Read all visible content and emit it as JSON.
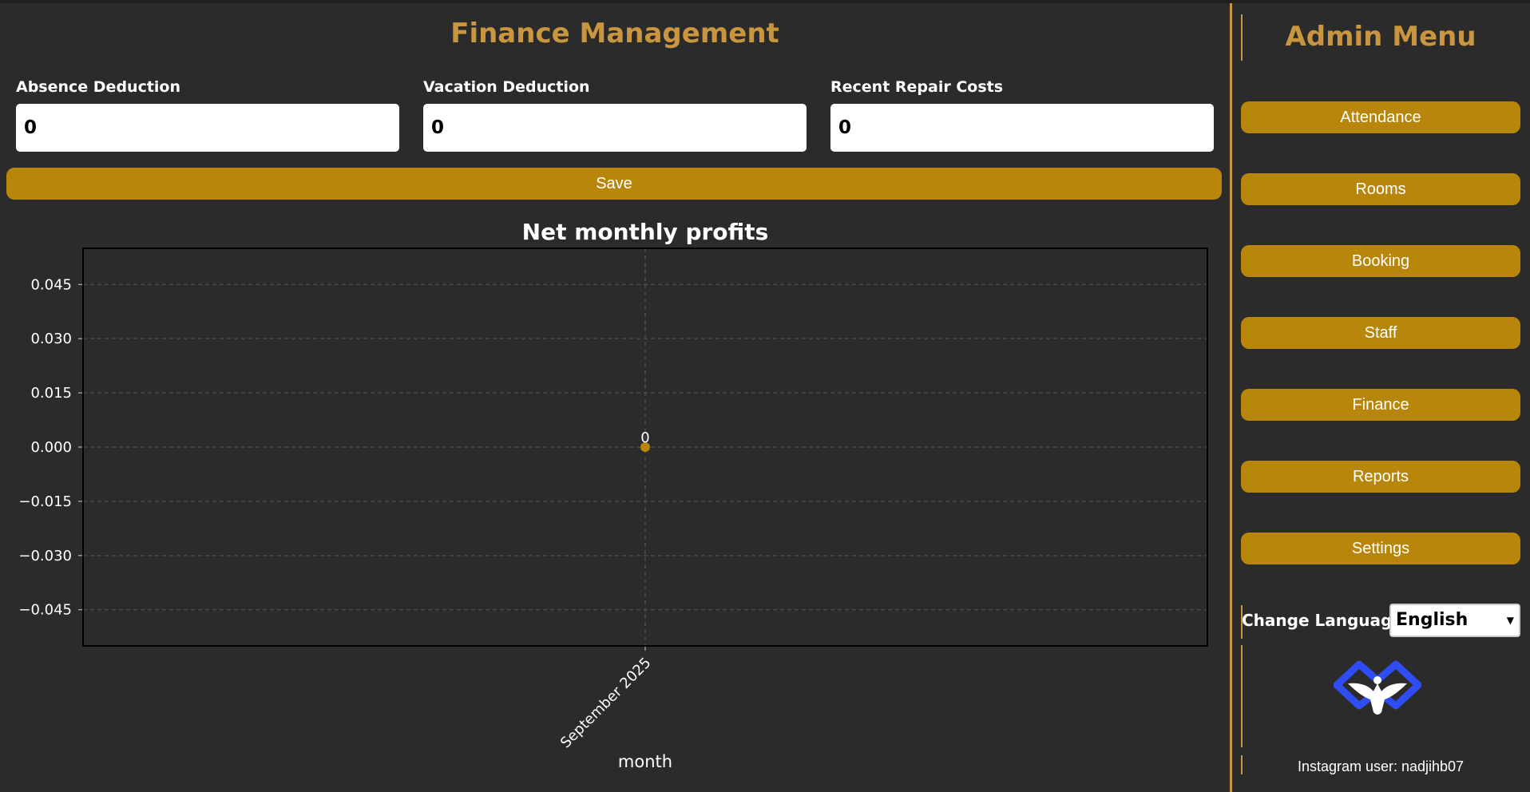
{
  "page_title": "Finance Management",
  "fields": [
    {
      "label": "Absence Deduction",
      "value": "0"
    },
    {
      "label": "Vacation Deduction",
      "value": "0"
    },
    {
      "label": "Recent Repair Costs",
      "value": "0"
    }
  ],
  "save_label": "Save",
  "chart_data": {
    "type": "line",
    "title": "Net monthly profits",
    "xlabel": "month",
    "ylabel": "",
    "categories": [
      "September 2025"
    ],
    "series": [
      {
        "values": [
          0
        ]
      }
    ],
    "data_labels": [
      "0"
    ],
    "ylim": [
      -0.055,
      0.055
    ],
    "yticks": [
      "0.045",
      "0.030",
      "0.015",
      "0.000",
      "−0.015",
      "−0.030",
      "−0.045"
    ],
    "ytick_values": [
      0.045,
      0.03,
      0.015,
      0.0,
      -0.015,
      -0.03,
      -0.045
    ],
    "grid": true,
    "point_color": "#b8860b",
    "background_color": "#2b2b2b"
  },
  "sidebar": {
    "title": "Admin Menu",
    "items": [
      "Attendance",
      "Rooms",
      "Booking",
      "Staff",
      "Finance",
      "Reports",
      "Settings"
    ],
    "change_language_label": "Change Language",
    "language_value": "English",
    "instagram_text": "Instagram user: nadjihb07"
  },
  "colors": {
    "accent": "#c9963f",
    "button": "#b8860b",
    "background": "#2b2b2b",
    "logo": "#2f4df5"
  }
}
